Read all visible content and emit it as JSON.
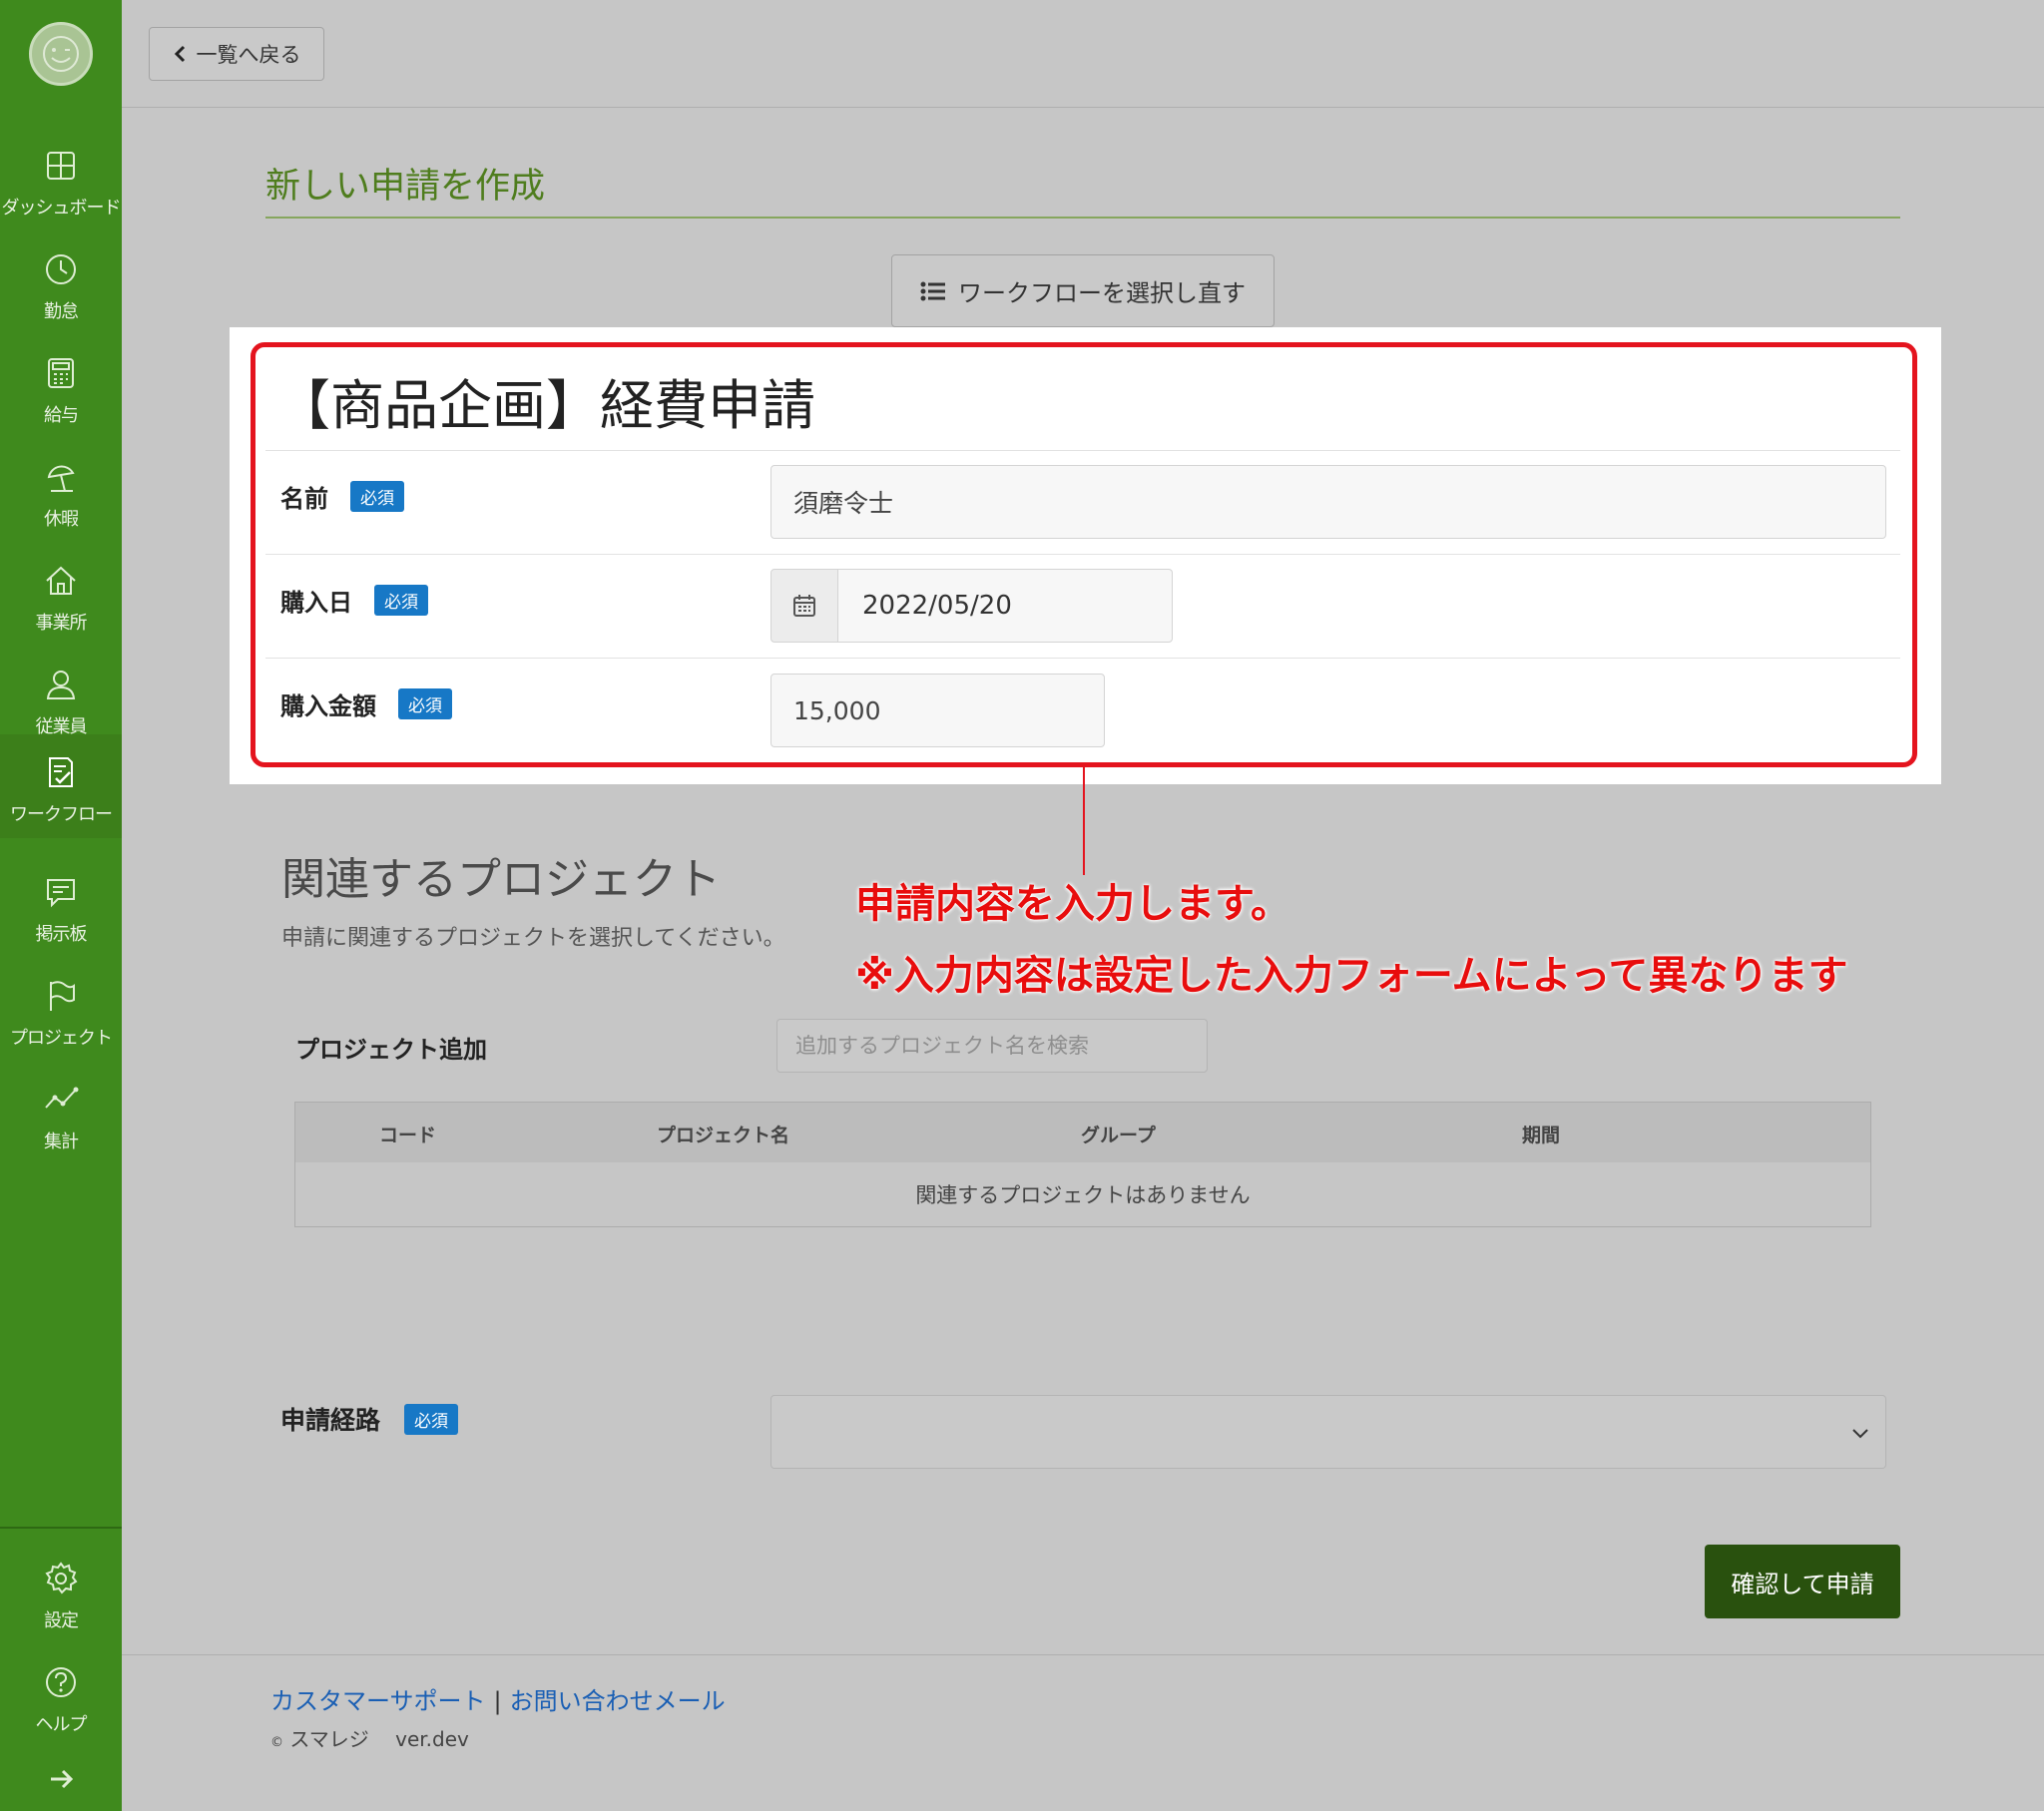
{
  "sidebar": {
    "items": [
      {
        "label": "ダッシュボード",
        "icon": "dashboard-icon"
      },
      {
        "label": "勤怠",
        "icon": "clock-icon"
      },
      {
        "label": "給与",
        "icon": "calculator-icon"
      },
      {
        "label": "休暇",
        "icon": "beach-umbrella-icon"
      },
      {
        "label": "事業所",
        "icon": "house-icon"
      },
      {
        "label": "従業員",
        "icon": "person-icon"
      },
      {
        "label": "ワークフロー",
        "icon": "document-check-icon",
        "active": true
      },
      {
        "label": "掲示板",
        "icon": "chat-bubble-icon"
      },
      {
        "label": "プロジェクト",
        "icon": "flag-icon"
      },
      {
        "label": "集計",
        "icon": "line-chart-icon"
      }
    ],
    "bottom_items": [
      {
        "label": "設定",
        "icon": "gear-icon"
      },
      {
        "label": "ヘルプ",
        "icon": "help-icon"
      }
    ]
  },
  "topbar": {
    "back_label": "一覧へ戻る"
  },
  "page": {
    "title": "新しい申請を作成",
    "reselect_label": "ワークフローを選択し直す"
  },
  "form": {
    "title": "【商品企画】経費申請",
    "required_badge": "必須",
    "name_label": "名前",
    "name_value": "須磨令士",
    "date_label": "購入日",
    "date_value": "2022/05/20",
    "amount_label": "購入金額",
    "amount_value": "15,000"
  },
  "annotation": {
    "line1": "申請内容を入力します。",
    "line2": "※入力内容は設定した入力フォームによって異なります",
    "color": "#e4141e"
  },
  "projects": {
    "title": "関連するプロジェクト",
    "description": "申請に関連するプロジェクトを選択してください。",
    "add_label": "プロジェクト追加",
    "search_placeholder": "追加するプロジェクト名を検索",
    "columns": [
      "コード",
      "プロジェクト名",
      "グループ",
      "期間"
    ],
    "empty_message": "関連するプロジェクトはありません"
  },
  "route": {
    "label": "申請経路",
    "required_badge": "必須"
  },
  "submit_label": "確認して申請",
  "footer": {
    "support_link": "カスタマーサポート",
    "separator": "|",
    "contact_link": "お問い合わせメール",
    "copyright_symbol": "©",
    "company": "スマレジ",
    "version": "ver.dev"
  },
  "colors": {
    "brand_green": "#3f8a1d",
    "submit_green": "#29510e",
    "badge_blue": "#1778c6"
  }
}
